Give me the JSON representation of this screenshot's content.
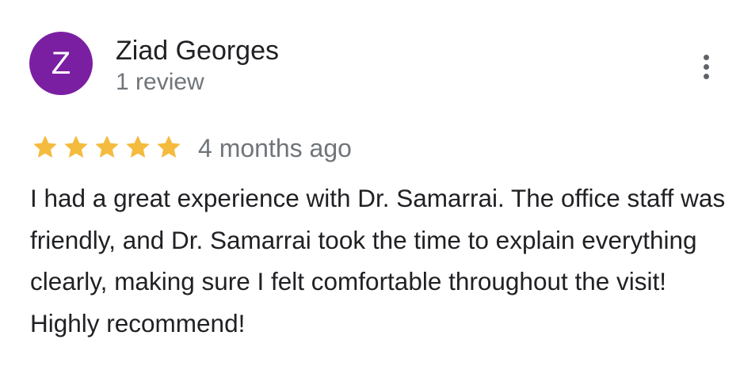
{
  "reviewer": {
    "initial": "Z",
    "name": "Ziad Georges",
    "review_count": "1 review",
    "avatar_color": "#7b1fa2"
  },
  "review": {
    "rating": 5,
    "max_rating": 5,
    "star_color": "#f4bb3f",
    "date": "4 months ago",
    "text": "I had a great experience with Dr. Samarrai. The office staff was friendly, and Dr. Samarrai took the time to explain everything clearly, making sure I felt comfortable throughout the visit! Highly recommend!"
  },
  "actions": {
    "more_icon": "more-vert-icon"
  }
}
